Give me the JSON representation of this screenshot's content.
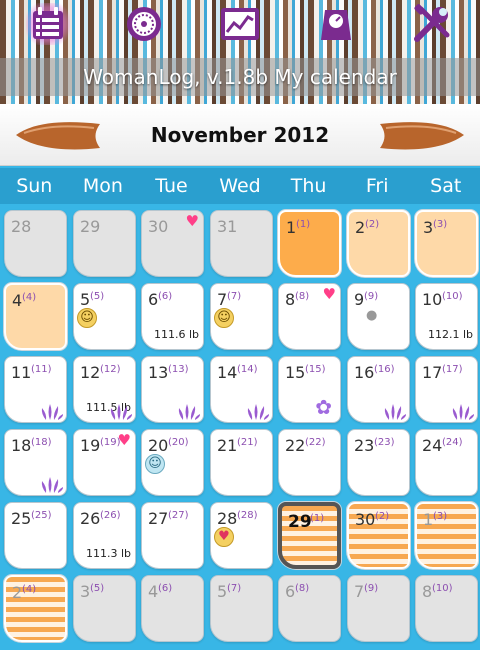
{
  "toolbar": {
    "buttons": [
      {
        "name": "calendar-list",
        "icon": "calendar-list-icon",
        "active": true
      },
      {
        "name": "cycle-wheel",
        "icon": "cycle-wheel-icon",
        "active": false
      },
      {
        "name": "chart",
        "icon": "chart-icon",
        "active": false
      },
      {
        "name": "scale",
        "icon": "scale-icon",
        "active": false
      },
      {
        "name": "settings",
        "icon": "tools-icon",
        "active": false
      }
    ]
  },
  "title": "WomanLog, v.1.8b My calendar",
  "month_label": "November 2012",
  "weekdays": [
    "Sun",
    "Mon",
    "Tue",
    "Wed",
    "Thu",
    "Fri",
    "Sat"
  ],
  "colors": {
    "header_blue": "#2a9fcf",
    "grid_blue": "#38b6e6",
    "period": "#fdac4b",
    "period_light": "#fed9a8",
    "forecast_stripe": "#f7a851",
    "cycle_day": "#8c4fb0"
  },
  "days": [
    {
      "d": "28",
      "c": "",
      "style": "grey"
    },
    {
      "d": "29",
      "c": "",
      "style": "grey"
    },
    {
      "d": "30",
      "c": "",
      "style": "grey",
      "marks": [
        "heart"
      ]
    },
    {
      "d": "31",
      "c": "",
      "style": "grey"
    },
    {
      "d": "1",
      "c": "(1)",
      "style": "orange"
    },
    {
      "d": "2",
      "c": "(2)",
      "style": "peach"
    },
    {
      "d": "3",
      "c": "(3)",
      "style": "peach"
    },
    {
      "d": "4",
      "c": "(4)",
      "style": "peach"
    },
    {
      "d": "5",
      "c": "(5)",
      "style": "white",
      "marks": [
        "smiley"
      ]
    },
    {
      "d": "6",
      "c": "(6)",
      "style": "white",
      "weight": "111.6 lb"
    },
    {
      "d": "7",
      "c": "(7)",
      "style": "white",
      "marks": [
        "smiley"
      ]
    },
    {
      "d": "8",
      "c": "(8)",
      "style": "white",
      "marks": [
        "heart"
      ]
    },
    {
      "d": "9",
      "c": "(9)",
      "style": "white",
      "marks": [
        "bubble"
      ]
    },
    {
      "d": "10",
      "c": "(10)",
      "style": "white",
      "weight": "112.1 lb"
    },
    {
      "d": "11",
      "c": "(11)",
      "style": "white",
      "marks": [
        "flower"
      ]
    },
    {
      "d": "12",
      "c": "(12)",
      "style": "white",
      "weight": "111.5 lb",
      "marks": [
        "flower"
      ]
    },
    {
      "d": "13",
      "c": "(13)",
      "style": "white",
      "marks": [
        "flower"
      ]
    },
    {
      "d": "14",
      "c": "(14)",
      "style": "white",
      "marks": [
        "flower"
      ]
    },
    {
      "d": "15",
      "c": "(15)",
      "style": "white",
      "marks": [
        "ovulation"
      ]
    },
    {
      "d": "16",
      "c": "(16)",
      "style": "white",
      "marks": [
        "flower"
      ]
    },
    {
      "d": "17",
      "c": "(17)",
      "style": "white",
      "marks": [
        "flower"
      ]
    },
    {
      "d": "18",
      "c": "(18)",
      "style": "white",
      "marks": [
        "flower"
      ]
    },
    {
      "d": "19",
      "c": "(19)",
      "style": "white",
      "marks": [
        "heart"
      ]
    },
    {
      "d": "20",
      "c": "(20)",
      "style": "white",
      "marks": [
        "smiley-blue"
      ]
    },
    {
      "d": "21",
      "c": "(21)",
      "style": "white"
    },
    {
      "d": "22",
      "c": "(22)",
      "style": "white"
    },
    {
      "d": "23",
      "c": "(23)",
      "style": "white"
    },
    {
      "d": "24",
      "c": "(24)",
      "style": "white"
    },
    {
      "d": "25",
      "c": "(25)",
      "style": "white"
    },
    {
      "d": "26",
      "c": "(26)",
      "style": "white",
      "weight": "111.3 lb"
    },
    {
      "d": "27",
      "c": "(27)",
      "style": "white"
    },
    {
      "d": "28",
      "c": "(28)",
      "style": "white",
      "marks": [
        "smiley-love"
      ]
    },
    {
      "d": "29",
      "c": "(1)",
      "style": "stripes",
      "today": true
    },
    {
      "d": "30",
      "c": "(2)",
      "style": "stripes"
    },
    {
      "d": "1",
      "c": "(3)",
      "style": "stripes",
      "muted": true
    },
    {
      "d": "2",
      "c": "(4)",
      "style": "stripes",
      "muted": true
    },
    {
      "d": "3",
      "c": "(5)",
      "style": "grey"
    },
    {
      "d": "4",
      "c": "(6)",
      "style": "grey"
    },
    {
      "d": "5",
      "c": "(7)",
      "style": "grey"
    },
    {
      "d": "6",
      "c": "(8)",
      "style": "grey"
    },
    {
      "d": "7",
      "c": "(9)",
      "style": "grey"
    },
    {
      "d": "8",
      "c": "(10)",
      "style": "grey"
    }
  ]
}
